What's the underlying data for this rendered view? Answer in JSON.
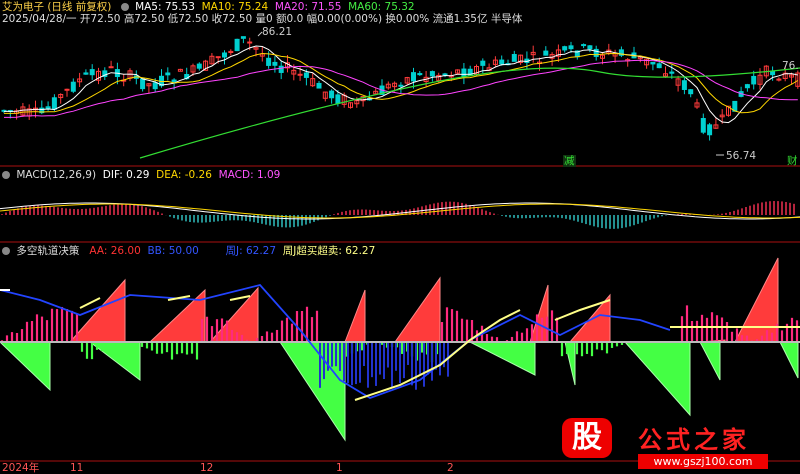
{
  "colors": {
    "bg": "#000000",
    "up": "#ff3b3b",
    "down": "#00d0d0",
    "ma5": "#ffffff",
    "ma10": "#ffd700",
    "ma20": "#ff44ff",
    "ma60": "#33dd33",
    "pink": "#ff2a7f",
    "green": "#44ff44",
    "blue": "#2233cc",
    "yellow": "#ffff88",
    "divider": "#aa1111"
  },
  "header": {
    "stock": "艾为电子 (日线 前复权)",
    "ma5": "MA5: 75.53",
    "ma10": "MA10: 75.24",
    "ma20": "MA20: 71.55",
    "ma60": "MA60: 75.32",
    "date": "2025/04/28/一",
    "open": "开72.50",
    "high": "高72.50",
    "low": "低72.50",
    "close": "收72.50",
    "vol": "量0",
    "amount": "额0.0",
    "amp": "幅0.00(0.00%)",
    "turnover": "换0.00%",
    "float": "流通1.35亿",
    "sector": "半导体"
  },
  "price": {
    "high_label": "86.21",
    "low_label": "56.74",
    "right_label": "76.",
    "badge_jian": "减",
    "badge_cai": "财"
  },
  "macd": {
    "title": "MACD(12,26,9)",
    "dif": "DIF: 0.29",
    "dea": "DEA: -0.26",
    "macd": "MACD: 1.09"
  },
  "indicator": {
    "title": "多空轨道决策",
    "aa": "AA: 26.00",
    "bb": "BB: 50.00",
    "zhou": "周J: 62.27",
    "zhou_overbought": "周J超买超卖: 62.27"
  },
  "xaxis": {
    "year": "2024年",
    "m11": "11",
    "m12": "12",
    "m1": "1",
    "m2": "2"
  },
  "watermark": {
    "logo": "股",
    "site": "公式之家",
    "url": "www.gszj100.com"
  }
}
